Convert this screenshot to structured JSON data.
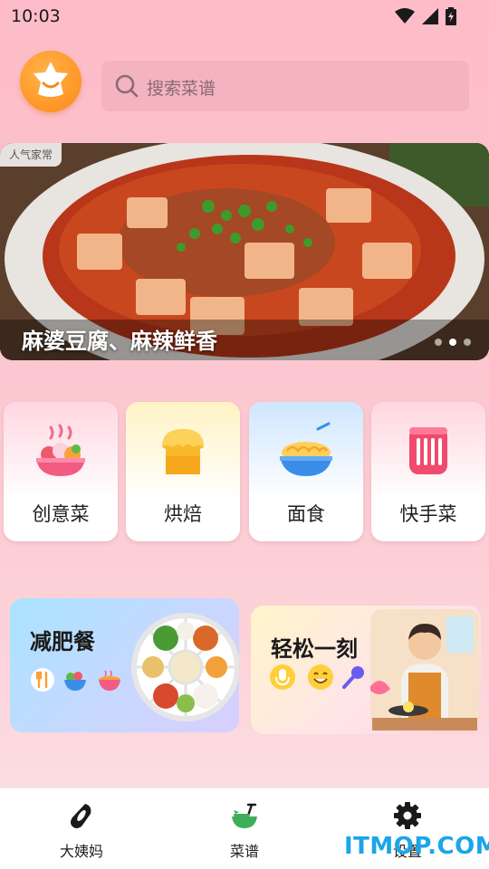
{
  "status_bar": {
    "time": "10:03"
  },
  "search": {
    "placeholder": "搜索菜谱"
  },
  "banner": {
    "tag": "人气家常",
    "caption": "麻婆豆腐、麻辣鲜香",
    "dot_count": 3,
    "active_dot": 1
  },
  "categories": [
    {
      "label": "创意菜",
      "icon": "salad-bowl-icon"
    },
    {
      "label": "烘焙",
      "icon": "bread-icon"
    },
    {
      "label": "面食",
      "icon": "noodle-bowl-icon"
    },
    {
      "label": "快手菜",
      "icon": "quick-dish-icon"
    }
  ],
  "features": [
    {
      "title": "减肥餐",
      "icons": [
        "fork-knife-icon",
        "veggie-bowl-icon",
        "soup-bowl-icon"
      ]
    },
    {
      "title": "轻松一刻",
      "icons": [
        "microphone-icon",
        "smile-icon",
        "karaoke-mic-icon"
      ]
    }
  ],
  "bottom_nav": [
    {
      "label": "大姨妈",
      "icon": "pad-icon"
    },
    {
      "label": "菜谱",
      "icon": "recipe-bowl-icon",
      "active": true
    },
    {
      "label": "设置",
      "icon": "gear-icon"
    }
  ],
  "watermark": "ITMOP.COM",
  "colors": {
    "accent_orange": "#ff9a2a",
    "nav_green": "#3fae5a",
    "watermark_blue": "#1aa6e8"
  }
}
